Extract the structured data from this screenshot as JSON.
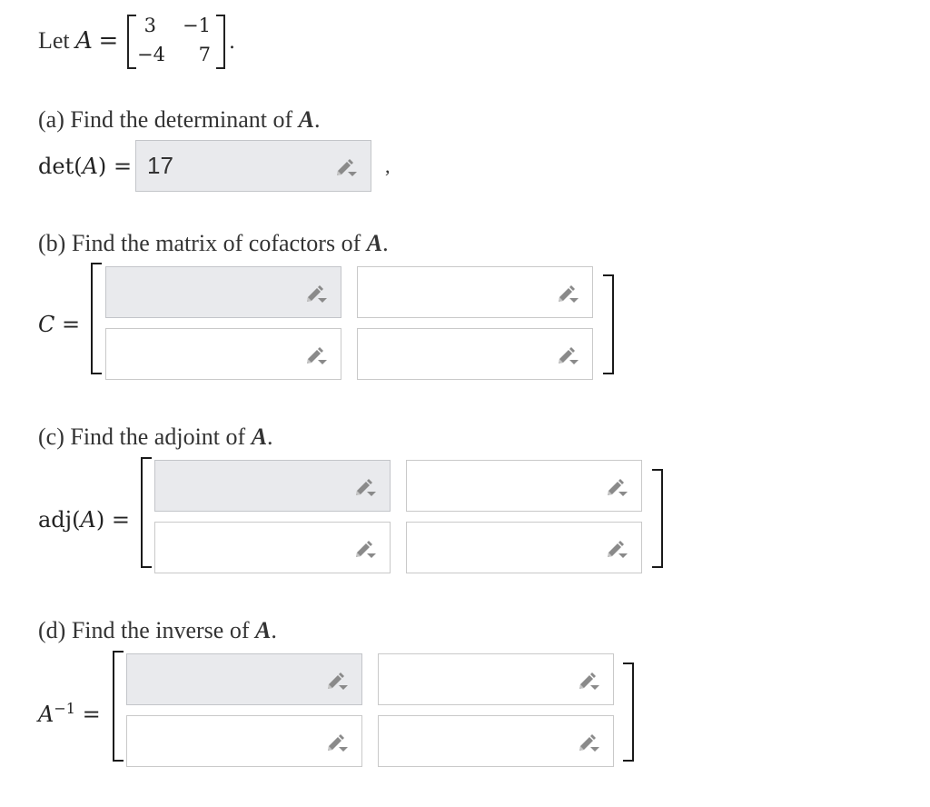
{
  "intro": {
    "let": "Let",
    "var": "A",
    "eq": "="
  },
  "given_matrix": {
    "r0c0": "3",
    "r0c1": "−1",
    "r1c0": "−4",
    "r1c1": "7",
    "period": "."
  },
  "part_a": {
    "label": "(a) Find the determinant of",
    "var": "A",
    "period": ".",
    "lhs": "det(",
    "lhs_var": "A",
    "lhs_close": ")",
    "eq": "=",
    "answer": "17",
    "comma": ","
  },
  "part_b": {
    "label": "(b) Find the matrix of cofactors of",
    "var": "A",
    "period": ".",
    "lhs_var": "C",
    "eq": "=",
    "cells": [
      "",
      "",
      "",
      ""
    ]
  },
  "part_c": {
    "label": "(c) Find the adjoint of",
    "var": "A",
    "period": ".",
    "lhs": "adj(",
    "lhs_var": "A",
    "lhs_close": ")",
    "eq": "=",
    "cells": [
      "",
      "",
      "",
      ""
    ]
  },
  "part_d": {
    "label": "(d) Find the inverse of",
    "var": "A",
    "period": ".",
    "lhs_var": "A",
    "lhs_sup": "−1",
    "eq": "=",
    "cells": [
      "",
      "",
      "",
      ""
    ]
  },
  "icons": {
    "edit": "pencil-dropdown-icon"
  },
  "colors": {
    "active_box": "#e9eaed",
    "box_border": "#c9c9c9",
    "text": "#333333"
  }
}
